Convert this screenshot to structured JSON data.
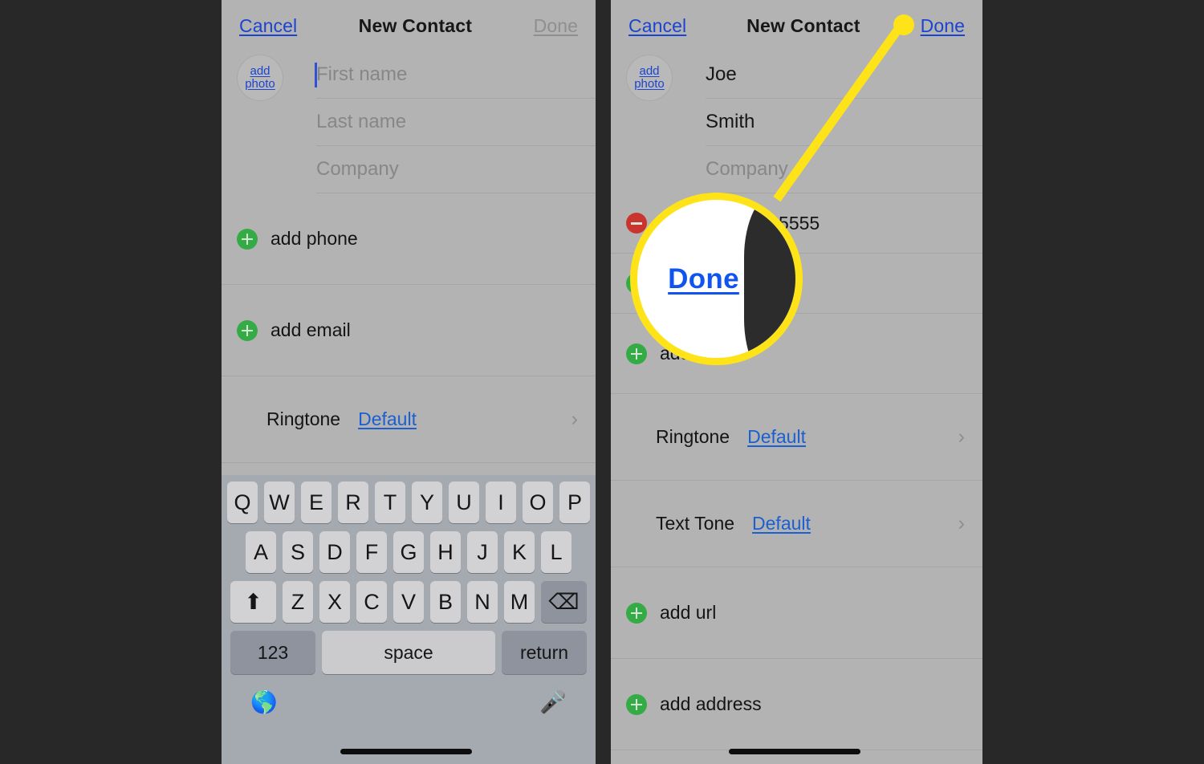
{
  "theme": {
    "background": "#282828",
    "panel_bg": "#b3b3b3",
    "link_blue": "#1b44cf",
    "value_blue": "#1b5fd0",
    "accent_yellow": "#ffe319",
    "add_green": "#34ab45",
    "remove_red": "#c9352e",
    "keyboard_bg": "#a5a9b0"
  },
  "left_screen": {
    "navbar": {
      "cancel_label": "Cancel",
      "title": "New Contact",
      "done_label": "Done",
      "done_enabled": false
    },
    "photo_button": {
      "line1": "add",
      "line2": "photo"
    },
    "name_fields": [
      {
        "placeholder": "First name",
        "value": "",
        "focused": true
      },
      {
        "placeholder": "Last name",
        "value": "",
        "focused": false
      },
      {
        "placeholder": "Company",
        "value": "",
        "focused": false
      }
    ],
    "rows": [
      {
        "type": "add",
        "label": "add phone"
      },
      {
        "type": "add",
        "label": "add email"
      }
    ],
    "settings": [
      {
        "key": "Ringtone",
        "value": "Default"
      }
    ],
    "keyboard": {
      "row1": [
        "Q",
        "W",
        "E",
        "R",
        "T",
        "Y",
        "U",
        "I",
        "O",
        "P"
      ],
      "row2": [
        "A",
        "S",
        "D",
        "F",
        "G",
        "H",
        "J",
        "K",
        "L"
      ],
      "row3": [
        "Z",
        "X",
        "C",
        "V",
        "B",
        "N",
        "M"
      ],
      "shift_icon": "shift-arrow-icon",
      "backspace_icon": "backspace-icon",
      "numbers_label": "123",
      "space_label": "space",
      "return_label": "return",
      "globe_icon": "globe-icon",
      "mic_icon": "microphone-icon"
    }
  },
  "right_screen": {
    "navbar": {
      "cancel_label": "Cancel",
      "title": "New Contact",
      "done_label": "Done",
      "done_enabled": true
    },
    "photo_button": {
      "line1": "add",
      "line2": "photo"
    },
    "name_fields": [
      {
        "placeholder": "First name",
        "value": "Joe",
        "focused": false
      },
      {
        "placeholder": "Last name",
        "value": "Smith",
        "focused": false
      },
      {
        "placeholder": "Company",
        "value": "",
        "focused": false
      }
    ],
    "phone_row": {
      "type": "remove",
      "value": "555-5555"
    },
    "rows": [
      {
        "type": "add",
        "label": "add email"
      },
      {
        "type": "add",
        "label": "add url"
      },
      {
        "type": "add",
        "label": "add address"
      }
    ],
    "settings": [
      {
        "key": "Ringtone",
        "value": "Default"
      },
      {
        "key": "Text Tone",
        "value": "Default"
      }
    ]
  },
  "callout": {
    "magnified_label": "Done",
    "target": "done-button"
  }
}
